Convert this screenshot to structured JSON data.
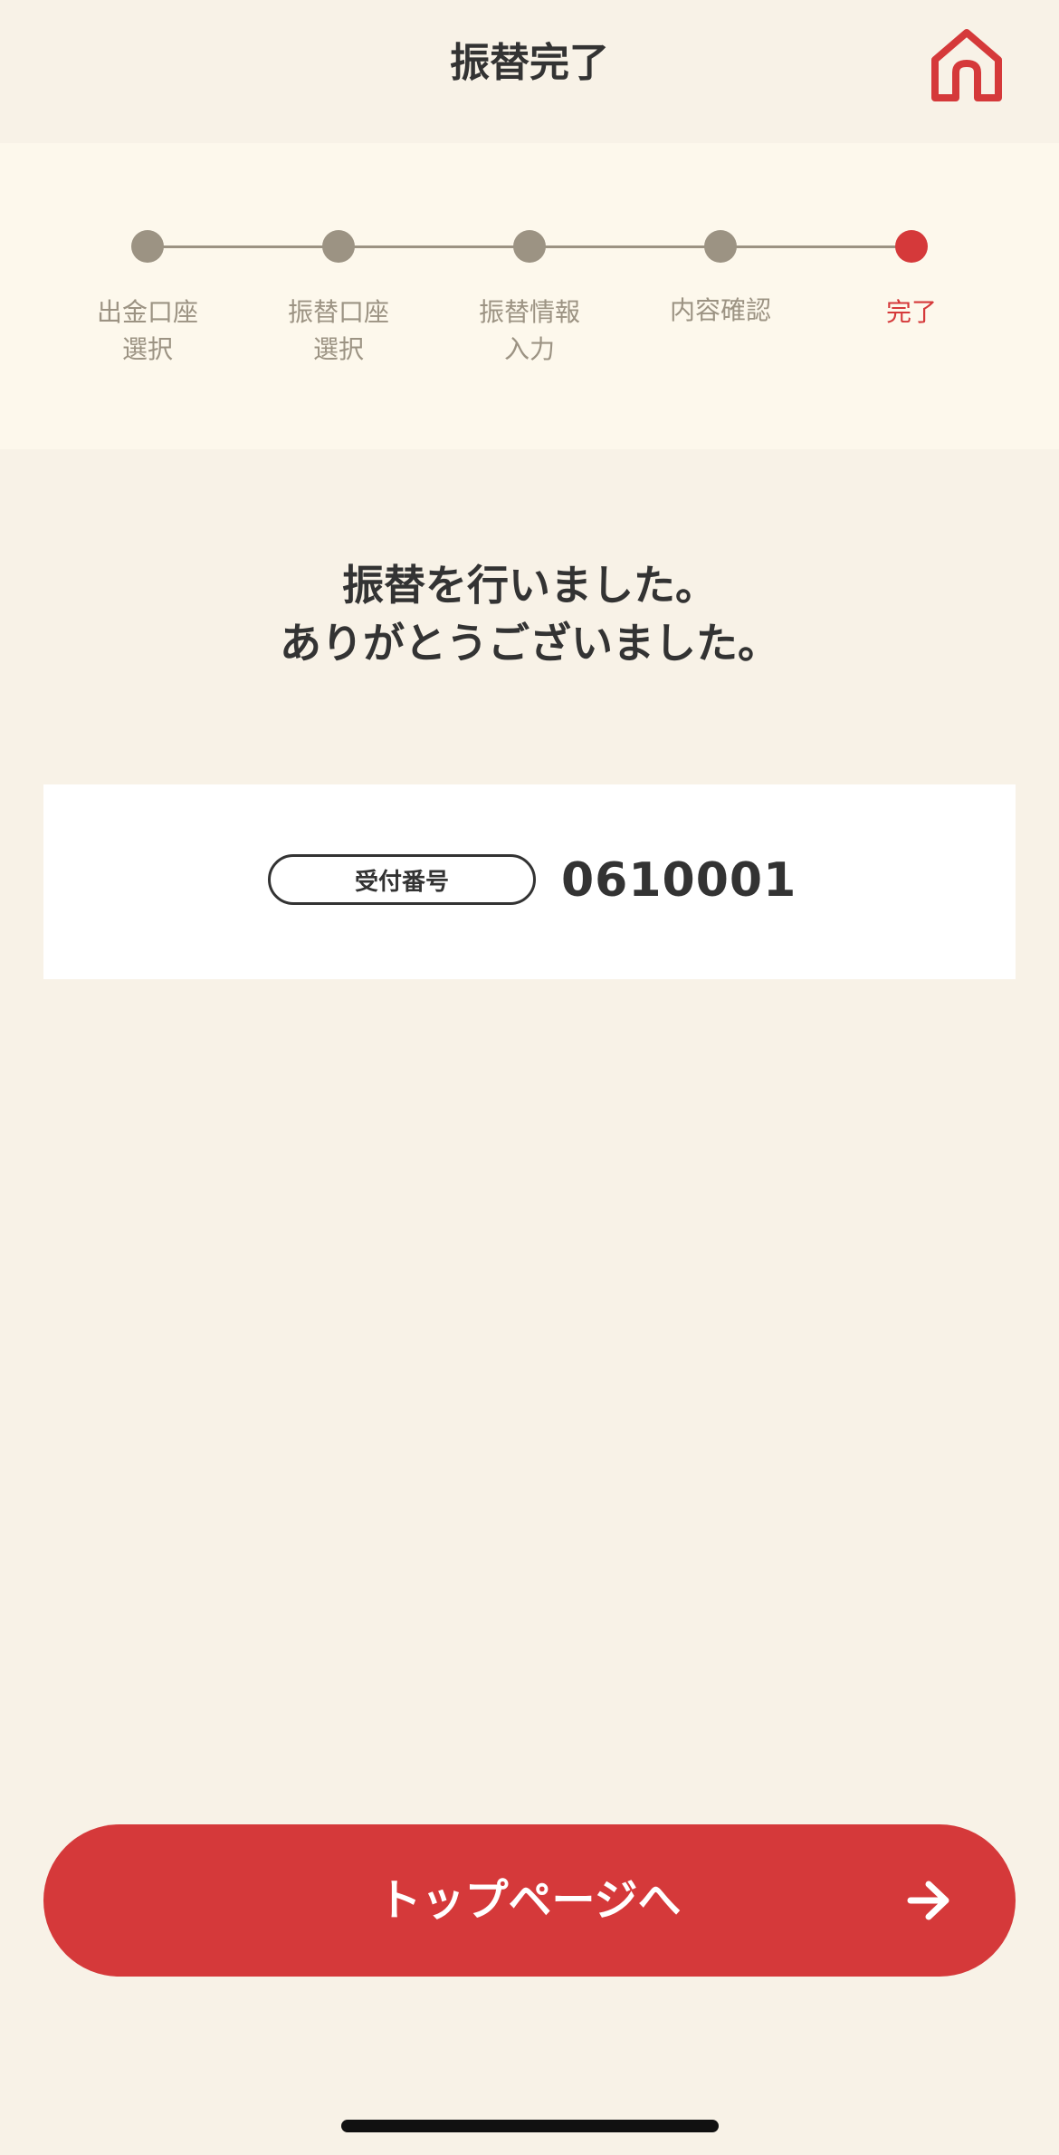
{
  "header": {
    "title": "振替完了",
    "home_icon": "home-icon"
  },
  "stepper": {
    "steps": [
      {
        "label": "出金口座\n選択",
        "state": "done"
      },
      {
        "label": "振替口座\n選択",
        "state": "done"
      },
      {
        "label": "振替情報\n入力",
        "state": "done"
      },
      {
        "label": "内容確認",
        "state": "done"
      },
      {
        "label": "完了",
        "state": "current"
      }
    ]
  },
  "message": {
    "line1": "振替を行いました。",
    "line2": "ありがとうございました。"
  },
  "receipt": {
    "label": "受付番号",
    "number": "0610001"
  },
  "actions": {
    "top_label": "トップページへ",
    "arrow_icon": "arrow-right-icon"
  },
  "colors": {
    "accent": "#d5393a",
    "background": "#f8f2e7",
    "stepper_background": "#fdf8ec",
    "step_done": "#9c9383",
    "text": "#333333"
  }
}
